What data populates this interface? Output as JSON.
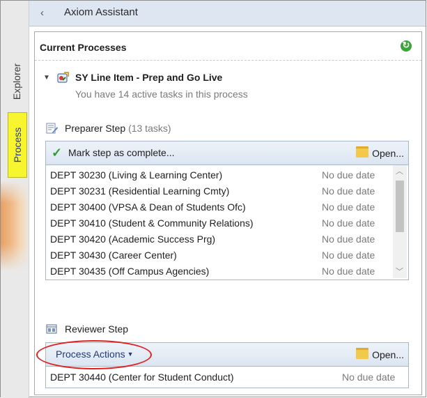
{
  "window": {
    "title": "Axiom Assistant",
    "collapse_icon": "chevron-left-icon"
  },
  "tabs": [
    {
      "label": "Explorer",
      "active": false
    },
    {
      "label": "Process",
      "active": true,
      "highlight_color": "#f6f52e"
    }
  ],
  "panel": {
    "title": "Current Processes",
    "refresh_icon": "refresh-icon",
    "process": {
      "title": "SY Line Item - Prep and Go Live",
      "subtitle": "You have 14 active tasks in this process"
    },
    "preparer_step": {
      "label": "Preparer Step",
      "count": "(13 tasks)",
      "mark_complete_label": "Mark step as complete...",
      "open_label": "Open...",
      "tasks": [
        {
          "name": "DEPT 30230 (Living & Learning Center)",
          "due": "No due date"
        },
        {
          "name": "DEPT 30231 (Residential Learning Cmty)",
          "due": "No due date"
        },
        {
          "name": "DEPT 30400 (VPSA & Dean of Students Ofc)",
          "due": "No due date"
        },
        {
          "name": "DEPT 30410 (Student & Community Relations)",
          "due": "No due date"
        },
        {
          "name": "DEPT 30420 (Academic Success Prg)",
          "due": "No due date"
        },
        {
          "name": "DEPT 30430 (Career Center)",
          "due": "No due date"
        },
        {
          "name": "DEPT 30435 (Off Campus Agencies)",
          "due": "No due date"
        }
      ]
    },
    "reviewer_step": {
      "label": "Reviewer Step",
      "process_actions_label": "Process Actions",
      "open_label": "Open...",
      "tasks": [
        {
          "name": "DEPT 30440 (Center for Student Conduct)",
          "due": "No due date"
        }
      ]
    }
  },
  "colors": {
    "accent": "#1f3a74",
    "highlight_circle": "#e02020",
    "check": "#2f9b2f"
  }
}
